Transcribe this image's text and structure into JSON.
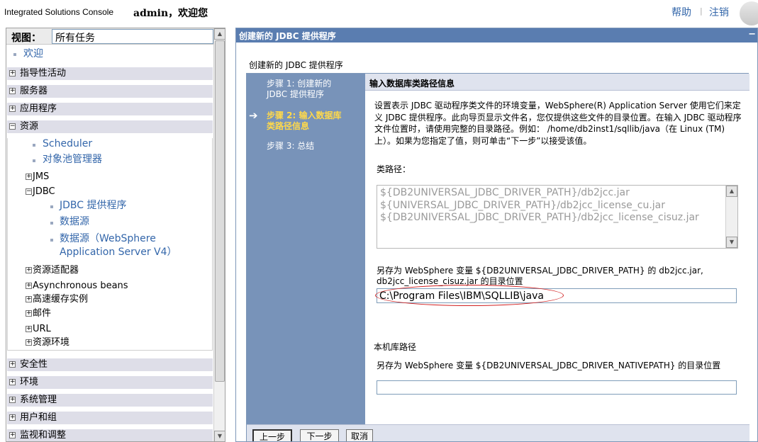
{
  "header": {
    "app_title": "Integrated Solutions Console",
    "greeting": "admin，欢迎您",
    "help": "帮助",
    "separator": "|",
    "logout": "注销"
  },
  "nav": {
    "view_label": "视图：",
    "view_value": "所有任务",
    "welcome": "欢迎",
    "categories": [
      {
        "label": "指导性活动",
        "state": "+"
      },
      {
        "label": "服务器",
        "state": "+"
      },
      {
        "label": "应用程序",
        "state": "+"
      },
      {
        "label": "资源",
        "state": "−"
      }
    ],
    "resources": {
      "scheduler": "Scheduler",
      "object_pool": "对象池管理器",
      "jms": "JMS",
      "jdbc": "JDBC",
      "jdbc_provider": "JDBC 提供程序",
      "datasource": "数据源",
      "datasource_v4_line1": "数据源（WebSphere",
      "datasource_v4_line2": "Application Server V4）",
      "adapters": "资源适配器",
      "async_beans": "Asynchronous beans",
      "cache": "高速缓存实例",
      "mail": "邮件",
      "url": "URL",
      "env": "资源环境"
    },
    "bottom_categories": [
      {
        "label": "安全性",
        "state": "+"
      },
      {
        "label": "环境",
        "state": "+"
      },
      {
        "label": "系统管理",
        "state": "+"
      },
      {
        "label": "用户和组",
        "state": "+"
      },
      {
        "label": "监视和调整",
        "state": "+"
      }
    ]
  },
  "main": {
    "header_title": "创建新的 JDBC 提供程序",
    "minimize": "−",
    "page_title": "创建新的 JDBC 提供程序",
    "steps": {
      "step1_line1": "步骤 1: 创建新的",
      "step1_line2": "JDBC 提供程序",
      "arrow": "➔",
      "step2_line1": "步骤 2: 输入数据库",
      "step2_line2": "类路径信息",
      "step3": "步骤 3: 总结"
    },
    "content_title": "输入数据库类路径信息",
    "description": "设置表示 JDBC 驱动程序类文件的环境变量，WebSphere(R) Application Server 使用它们来定义 JDBC 提供程序。此向导页显示文件名，您仅提供这些文件的目录位置。在输入 JDBC 驱动程序文件位置时，请使用完整的目录路径。例如： /home/db2inst1/sqllib/java（在 Linux (TM) 上）。如果为您指定了值，则可单击“下一步”以接受该值。",
    "classpath_label": "类路径：",
    "classpath_lines": [
      "${DB2UNIVERSAL_JDBC_DRIVER_PATH}/db2jcc.jar",
      "${UNIVERSAL_JDBC_DRIVER_PATH}/db2jcc_license_cu.jar",
      "${DB2UNIVERSAL_JDBC_DRIVER_PATH}/db2jcc_license_cisuz.jar"
    ],
    "save_desc": "另存为 WebSphere 变量 ${DB2UNIVERSAL_JDBC_DRIVER_PATH} 的 db2jcc.jar, db2jcc_license_cisuz.jar 的目录位置",
    "path_value": "C:\\Program Files\\IBM\\SQLLIB\\java",
    "native_label": "本机库路径",
    "native_desc": "另存为 WebSphere 变量 ${DB2UNIVERSAL_JDBC_DRIVER_NATIVEPATH} 的目录位置",
    "native_value": "",
    "buttons": {
      "prev": "上一步",
      "next": "下一步",
      "cancel": "取消"
    }
  },
  "colors": {
    "panel_header": "#5a7db0",
    "steps_bg": "#7893b9",
    "active_step": "#ffd94a",
    "link": "#3366aa",
    "highlight_circle": "#d12020"
  },
  "icons": [
    "expand-plus-icon",
    "collapse-minus-icon",
    "bullet-icon",
    "current-step-arrow-icon",
    "scroll-up-icon",
    "scroll-down-icon"
  ]
}
